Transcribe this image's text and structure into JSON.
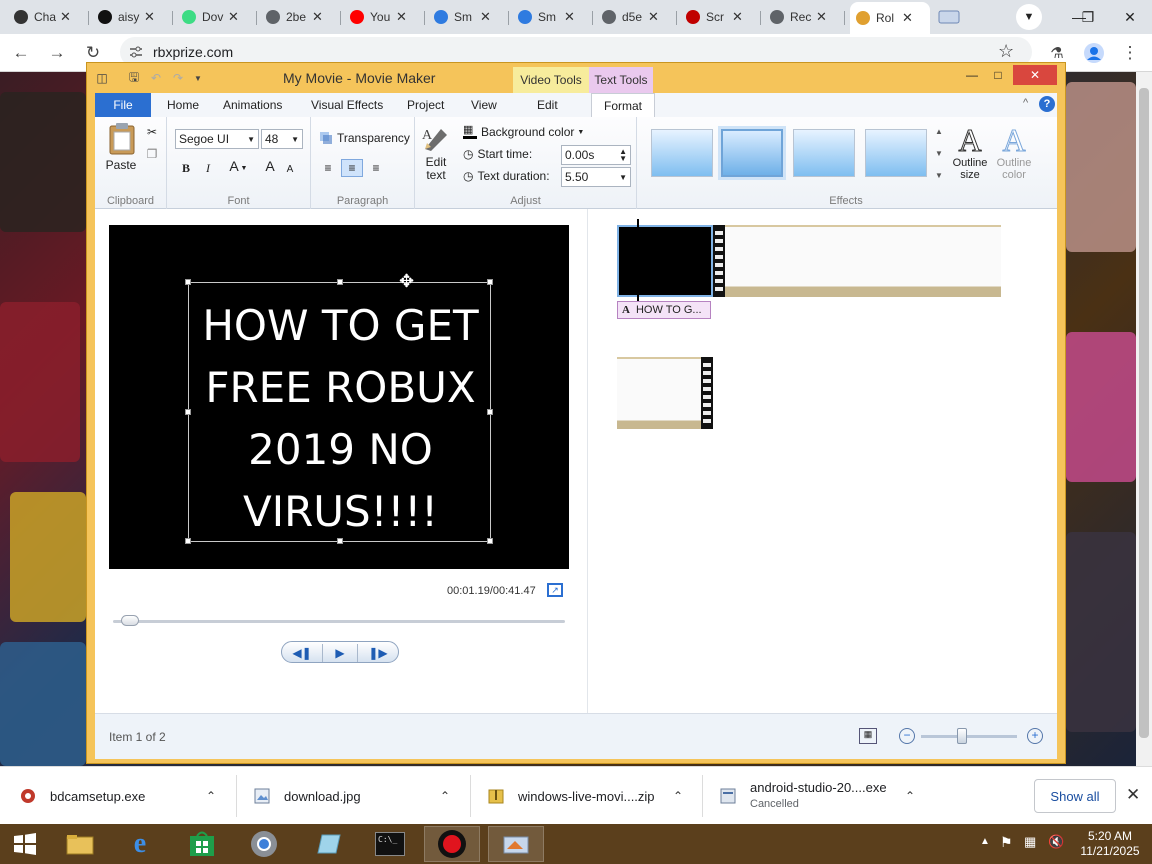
{
  "browser": {
    "tabs": [
      {
        "label": "Cha",
        "icon": "chatgpt-icon",
        "color": "#333333"
      },
      {
        "label": "aisy",
        "icon": "github-icon",
        "color": "#111111"
      },
      {
        "label": "Dov",
        "icon": "android-icon",
        "color": "#3ddc84"
      },
      {
        "label": "2be",
        "icon": "globe-icon",
        "color": "#5f6368"
      },
      {
        "label": "You",
        "icon": "youtube-icon",
        "color": "#ff0000"
      },
      {
        "label": "Sm",
        "icon": "smash-icon",
        "color": "#2f7be0"
      },
      {
        "label": "Sm",
        "icon": "smash-icon",
        "color": "#2f7be0"
      },
      {
        "label": "d5e",
        "icon": "globe-icon",
        "color": "#5f6368"
      },
      {
        "label": "Scr",
        "icon": "record-icon",
        "color": "#c00000"
      },
      {
        "label": "Rec",
        "icon": "globe-icon",
        "color": "#5f6368"
      },
      {
        "label": "Rol",
        "icon": "roblox-icon",
        "color": "#e0a030"
      }
    ],
    "url": "rbxprize.com"
  },
  "moviemaker": {
    "title": "My Movie - Movie Maker",
    "context_tabs": {
      "video_tools": "Video Tools",
      "text_tools": "Text Tools"
    },
    "ribbon_tabs": [
      "File",
      "Home",
      "Animations",
      "Visual Effects",
      "Project",
      "View",
      "Edit",
      "Format"
    ],
    "clipboard": {
      "paste": "Paste",
      "group": "Clipboard"
    },
    "font": {
      "family": "Segoe UI",
      "size": "48",
      "group": "Font",
      "bold": "B",
      "italic": "I",
      "color": "A",
      "grow": "A",
      "shrink": "A"
    },
    "paragraph": {
      "transparency": "Transparency",
      "group": "Paragraph"
    },
    "adjust": {
      "edit_text": "Edit text",
      "background_color": "Background color",
      "start_time_label": "Start time:",
      "start_time": "0.00s",
      "duration_label": "Text duration:",
      "duration": "5.50",
      "group": "Adjust"
    },
    "effects": {
      "group": "Effects",
      "outline_size": "Outline size",
      "outline_color": "Outline color",
      "selected_index": 1
    },
    "preview": {
      "overlay_lines": [
        "HOW TO GET",
        "FREE ROBUX",
        "2019 NO",
        "VIRUS!!!!"
      ],
      "timecode": "00:01.19/00:41.47",
      "progress": 0.03
    },
    "storyboard": {
      "caption": "HOW TO G..."
    },
    "status": {
      "item": "Item 1 of 2"
    },
    "colors": {
      "accent": "#f5c45a",
      "file_tab": "#2b6fd1"
    }
  },
  "downloads": [
    {
      "name": "bdcamsetup.exe",
      "status": ""
    },
    {
      "name": "download.jpg",
      "status": ""
    },
    {
      "name": "windows-live-movi....zip",
      "status": ""
    },
    {
      "name": "android-studio-20....exe",
      "status": "Cancelled"
    }
  ],
  "downloads_bar": {
    "show_all": "Show all"
  },
  "taskbar": {
    "time": "5:20 AM",
    "date": "11/21/2025"
  }
}
